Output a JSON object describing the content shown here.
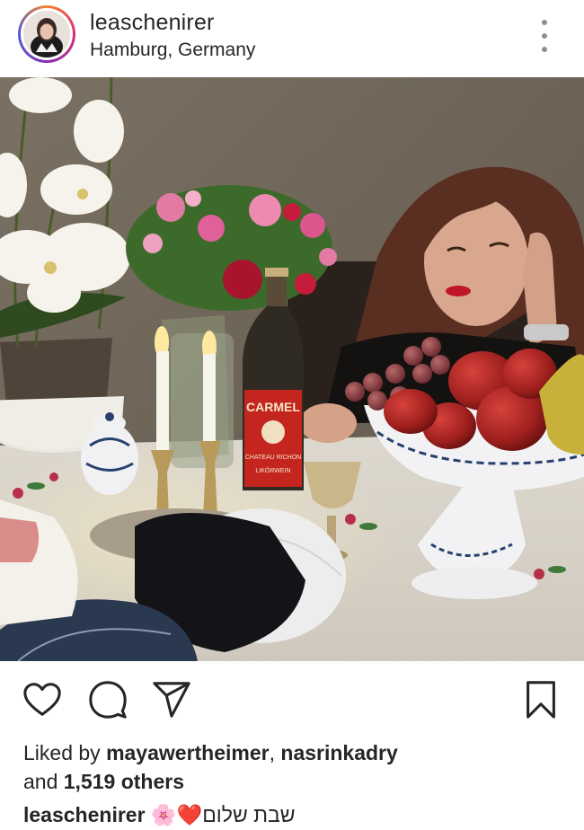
{
  "post": {
    "username": "leaschenirer",
    "location": "Hamburg, Germany"
  },
  "photo": {
    "bottle_label_line1": "CARMEL",
    "bottle_label_line2": "CHATEAU RICHON",
    "bottle_label_line3": "LIKÖRWEIN"
  },
  "actions": {
    "like_icon": "heart-icon",
    "comment_icon": "comment-icon",
    "share_icon": "paper-plane-icon",
    "save_icon": "bookmark-icon"
  },
  "likes": {
    "prefix": "Liked by ",
    "user1": "mayawertheimer",
    "separator": ", ",
    "user2": "nasrinkadry",
    "and": "and ",
    "count": "1,519 others"
  },
  "caption": {
    "username": "leaschenirer",
    "text": "🌸❤️שבת שלום"
  }
}
